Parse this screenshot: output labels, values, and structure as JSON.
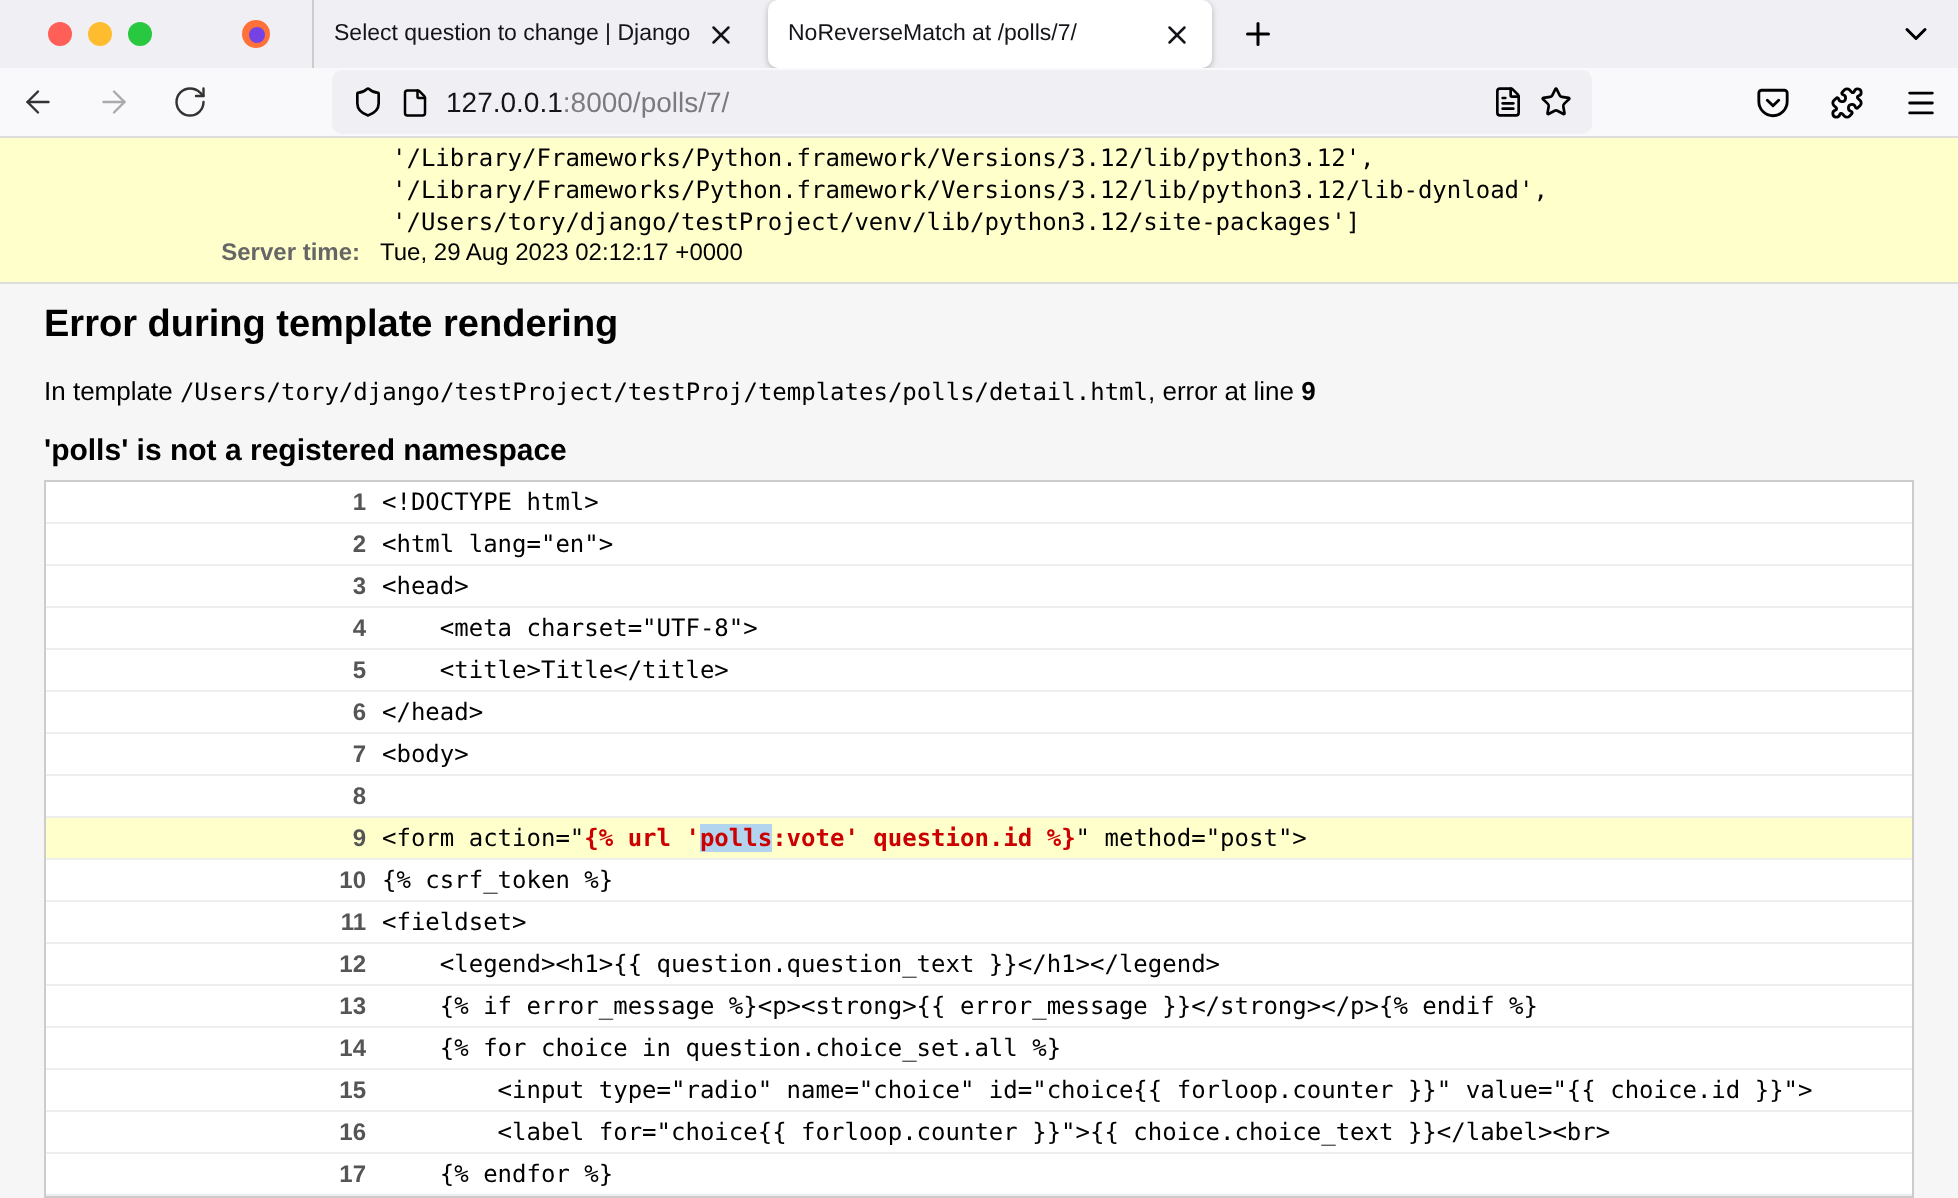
{
  "browser": {
    "tabs": [
      {
        "title": "Select question to change | Django",
        "selected": false
      },
      {
        "title": "NoReverseMatch at /polls/7/",
        "selected": true
      }
    ],
    "address": {
      "host": "127.0.0.1",
      "rest": ":8000/polls/7/"
    }
  },
  "summary": {
    "path_lines": [
      "'/Library/Frameworks/Python.framework/Versions/3.12/lib/python3.12',",
      "'/Library/Frameworks/Python.framework/Versions/3.12/lib/python3.12/lib-dynload',",
      "'/Users/tory/django/testProject/venv/lib/python3.12/site-packages']"
    ],
    "server_time_label": "Server time:",
    "server_time": "Tue, 29 Aug 2023 02:12:17 +0000"
  },
  "template": {
    "title": "Error during template rendering",
    "intro": "In template",
    "path": "/Users/tory/django/testProject/testProj/templates/polls/detail.html",
    "error_at": ", error at line",
    "line": "9",
    "message": "'polls' is not a registered namespace",
    "lines": [
      {
        "number": "1",
        "error": false,
        "segments": [
          {
            "kind": "plain",
            "text": "<!DOCTYPE html>"
          }
        ]
      },
      {
        "number": "2",
        "error": false,
        "segments": [
          {
            "kind": "plain",
            "text": "<html lang=\"en\">"
          }
        ]
      },
      {
        "number": "3",
        "error": false,
        "segments": [
          {
            "kind": "plain",
            "text": "<head>"
          }
        ]
      },
      {
        "number": "4",
        "error": false,
        "segments": [
          {
            "kind": "plain",
            "text": "    <meta charset=\"UTF-8\">"
          }
        ]
      },
      {
        "number": "5",
        "error": false,
        "segments": [
          {
            "kind": "plain",
            "text": "    <title>Title</title>"
          }
        ]
      },
      {
        "number": "6",
        "error": false,
        "segments": [
          {
            "kind": "plain",
            "text": "</head>"
          }
        ]
      },
      {
        "number": "7",
        "error": false,
        "segments": [
          {
            "kind": "plain",
            "text": "<body>"
          }
        ]
      },
      {
        "number": "8",
        "error": false
      },
      {
        "number": "9",
        "error": true,
        "segments": [
          {
            "kind": "plain",
            "text": "<form action=\""
          },
          {
            "kind": "error",
            "text": "{% url '"
          },
          {
            "kind": "selection",
            "text": "polls"
          },
          {
            "kind": "error",
            "text": ":vote' question.id %}"
          },
          {
            "kind": "plain",
            "text": "\" method=\"post\">"
          }
        ]
      },
      {
        "number": "10",
        "error": false,
        "segments": [
          {
            "kind": "plain",
            "text": "{% csrf_token %}"
          }
        ]
      },
      {
        "number": "11",
        "error": false,
        "segments": [
          {
            "kind": "plain",
            "text": "<fieldset>"
          }
        ]
      },
      {
        "number": "12",
        "error": false,
        "segments": [
          {
            "kind": "plain",
            "text": "    <legend><h1>{{ question.question_text }}</h1></legend>"
          }
        ]
      },
      {
        "number": "13",
        "error": false,
        "segments": [
          {
            "kind": "plain",
            "text": "    {% if error_message %}<p><strong>{{ error_message }}</strong></p>{% endif %}"
          }
        ]
      },
      {
        "number": "14",
        "error": false,
        "segments": [
          {
            "kind": "plain",
            "text": "    {% for choice in question.choice_set.all %}"
          }
        ]
      },
      {
        "number": "15",
        "error": false,
        "segments": [
          {
            "kind": "plain",
            "text": "        <input type=\"radio\" name=\"choice\" id=\"choice{{ forloop.counter }}\" value=\"{{ choice.id }}\">"
          }
        ]
      },
      {
        "number": "16",
        "error": false,
        "segments": [
          {
            "kind": "plain",
            "text": "        <label for=\"choice{{ forloop.counter }}\">{{ choice.choice_text }}</label><br>"
          }
        ]
      },
      {
        "number": "17",
        "error": false,
        "segments": [
          {
            "kind": "plain",
            "text": "    {% endfor %}"
          }
        ]
      }
    ]
  }
}
